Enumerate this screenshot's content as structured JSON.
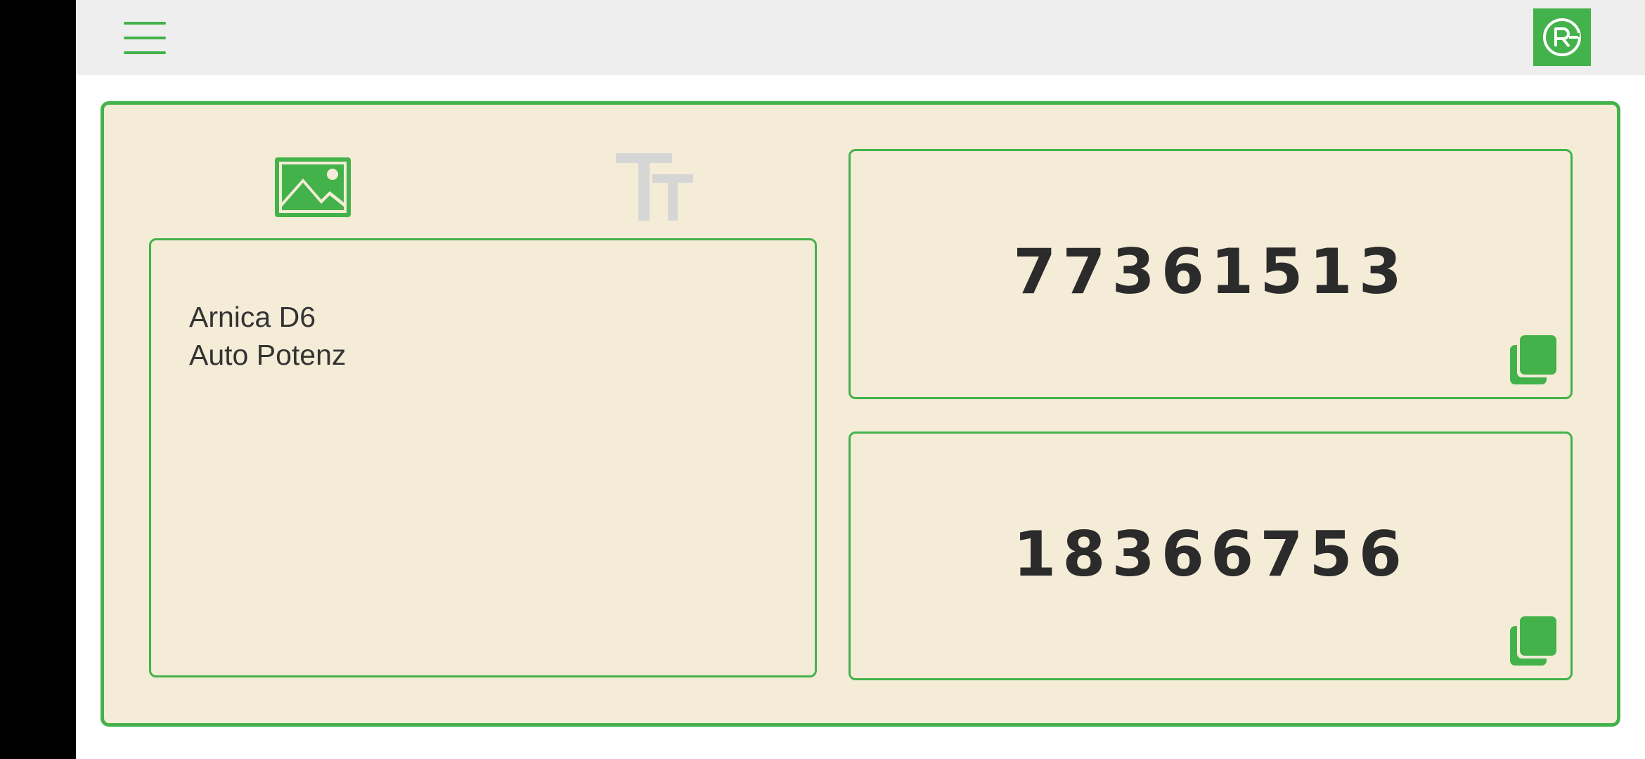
{
  "header": {
    "menu_icon": "hamburger-menu-icon",
    "logo_icon": "rg-logo-icon",
    "accent_color": "#43b24a"
  },
  "tabs": [
    {
      "icon": "image-icon",
      "active": true
    },
    {
      "icon": "text-size-icon",
      "active": false
    }
  ],
  "text_panel": {
    "lines": [
      "Arnica D6",
      "Auto Potenz"
    ]
  },
  "codes": [
    {
      "value": "77361513",
      "copy_icon": "copy-icon"
    },
    {
      "value": "18366756",
      "copy_icon": "copy-icon"
    }
  ],
  "colors": {
    "card_background": "#f4ecd7",
    "border": "#43b24a",
    "topbar": "#eeeeee",
    "inactive_icon": "#d6d6d6"
  }
}
